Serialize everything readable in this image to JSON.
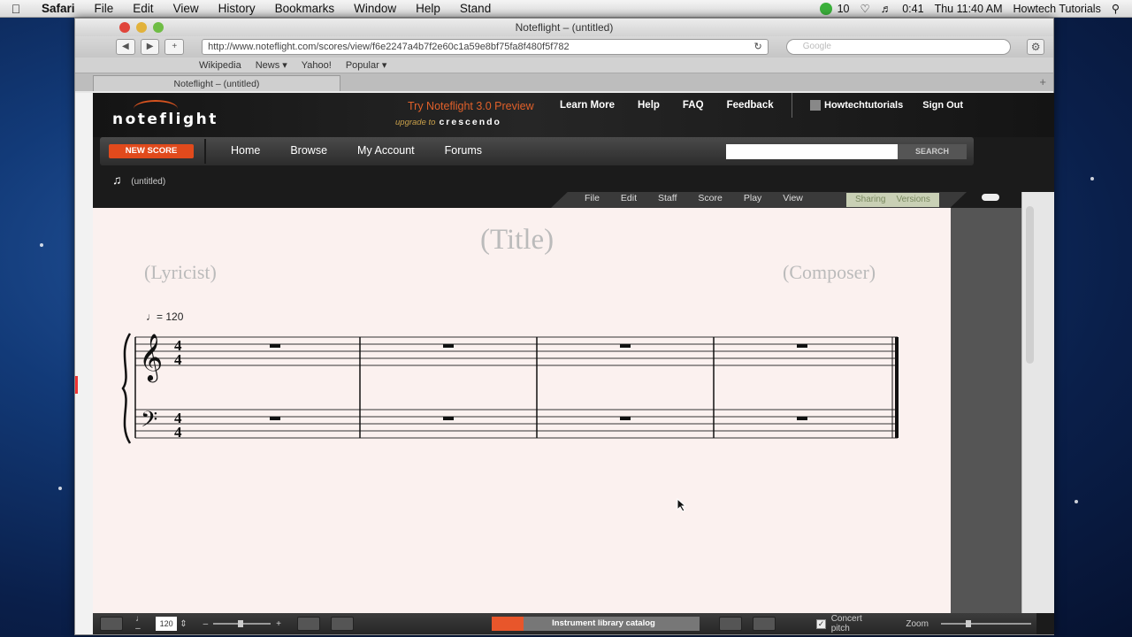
{
  "menubar": {
    "app": "Safari",
    "items": [
      "File",
      "Edit",
      "View",
      "History",
      "Bookmarks",
      "Window",
      "Help",
      "Stand"
    ],
    "status_text": "10",
    "battery": "0:41",
    "clock": "Thu 11:40 AM",
    "user": "Howtech Tutorials"
  },
  "browser": {
    "window_title": "Noteflight – (untitled)",
    "url": "http://www.noteflight.com/scores/view/f6e2247a4b7f2e60c1a59e8bf75fa8f480f5f782",
    "search_placeholder": "Google",
    "bookmarks": [
      "Wikipedia",
      "News ▾",
      "Yahoo!",
      "Popular ▾"
    ],
    "tab_title": "Noteflight – (untitled)"
  },
  "site": {
    "logo": "noteflight",
    "promo": "Try Noteflight 3.0 Preview",
    "promo_sub": "upgrade to",
    "promo_brand": "crescendo",
    "top_links": [
      "Learn More",
      "Help",
      "FAQ",
      "Feedback"
    ],
    "user_name": "Howtechtutorials",
    "sign_out": "Sign Out",
    "new_score": "NEW SCORE",
    "nav": [
      "Home",
      "Browse",
      "My Account",
      "Forums"
    ],
    "search_button": "SEARCH",
    "score_name": "(untitled)"
  },
  "editor": {
    "menus": [
      "File",
      "Edit",
      "Staff",
      "Score",
      "Play",
      "View"
    ],
    "right_tabs": [
      "Sharing",
      "Versions"
    ],
    "title": "(Title)",
    "lyricist": "(Lyricist)",
    "composer": "(Composer)",
    "tempo": "= 120",
    "time_signature": [
      "4",
      "4"
    ],
    "measures": 4
  },
  "bottom": {
    "tempo_value": "120",
    "instrument_library": "Instrument library catalog",
    "concert_pitch": "Concert pitch",
    "zoom": "Zoom"
  },
  "colors": {
    "accent": "#e14a1c",
    "page": "#fbf1ef",
    "chrome": "#1b1b1b"
  }
}
